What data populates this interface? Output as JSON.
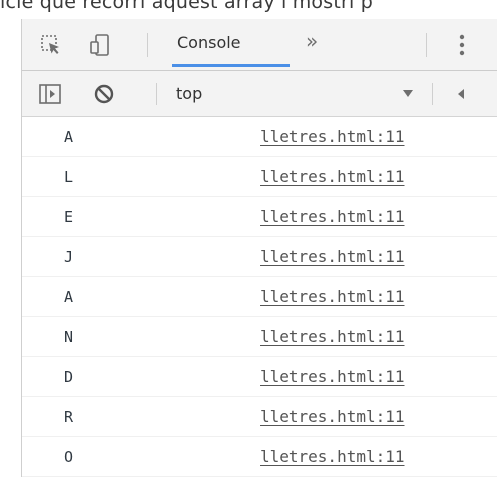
{
  "page_text": {
    "caption": "icle que recorri aquest array i mostri p"
  },
  "toolbar": {
    "inspect_icon": "inspect-element-icon",
    "device_icon": "device-toolbar-icon",
    "tab_console": "Console",
    "more_tabs": "»",
    "menu_icon": "kebab-menu-icon"
  },
  "filterbar": {
    "sidebar_icon": "show-sidebar-icon",
    "clear_icon": "clear-console-icon",
    "context": "top",
    "dropdown_icon": "dropdown-arrow-icon"
  },
  "colors": {
    "accent": "#4a8fe7",
    "toolbar_bg": "#f3f3f3"
  },
  "console": {
    "messages": [
      {
        "text": "A",
        "source": "lletres.html:11"
      },
      {
        "text": "L",
        "source": "lletres.html:11"
      },
      {
        "text": "E",
        "source": "lletres.html:11"
      },
      {
        "text": "J",
        "source": "lletres.html:11"
      },
      {
        "text": "A",
        "source": "lletres.html:11"
      },
      {
        "text": "N",
        "source": "lletres.html:11"
      },
      {
        "text": "D",
        "source": "lletres.html:11"
      },
      {
        "text": "R",
        "source": "lletres.html:11"
      },
      {
        "text": "O",
        "source": "lletres.html:11"
      }
    ]
  }
}
